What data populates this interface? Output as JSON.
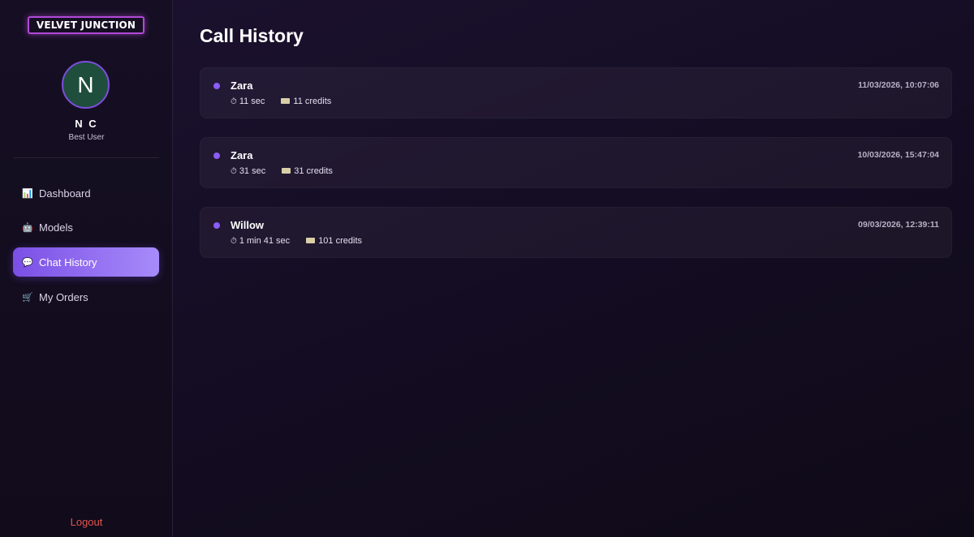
{
  "brand": {
    "logo_text": "VELVET JUNCTION"
  },
  "user": {
    "avatar_letter": "N",
    "name": "N C",
    "role": "Best User"
  },
  "nav": {
    "items": [
      {
        "icon": "dashboard-icon",
        "glyph": "📊",
        "label": "Dashboard",
        "active": false
      },
      {
        "icon": "models-icon",
        "glyph": "🤖",
        "label": "Models",
        "active": false
      },
      {
        "icon": "chat-icon",
        "glyph": "💬",
        "label": "Chat History",
        "active": true
      },
      {
        "icon": "cart-icon",
        "glyph": "🛒",
        "label": "My Orders",
        "active": false
      }
    ],
    "logout_label": "Logout"
  },
  "page": {
    "title": "Call History"
  },
  "calls": [
    {
      "caller": "Zara",
      "duration": "11 sec",
      "credits": "11 credits",
      "timestamp": "11/03/2026, 10:07:06"
    },
    {
      "caller": "Zara",
      "duration": "31 sec",
      "credits": "31 credits",
      "timestamp": "10/03/2026, 15:47:04"
    },
    {
      "caller": "Willow",
      "duration": "1 min 41 sec",
      "credits": "101 credits",
      "timestamp": "09/03/2026, 12:39:11"
    }
  ],
  "colors": {
    "accent": "#8b5cf6",
    "active_nav_start": "#7b4fe6",
    "active_nav_end": "#a78bfa",
    "logout": "#e2564f",
    "avatar_bg": "#1f4e3d"
  }
}
